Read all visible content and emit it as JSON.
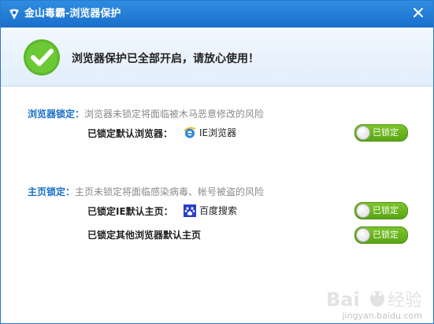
{
  "window": {
    "title": "金山毒霸-浏览器保护",
    "close_glyph": "×"
  },
  "banner": {
    "message": "浏览器保护已全部开启，请放心使用！"
  },
  "sections": [
    {
      "heading": "浏览器锁定：",
      "description": "浏览器未锁定将面临被木马恶意修改的风险",
      "rows": [
        {
          "label": "已锁定默认浏览器：",
          "value": "IE浏览器",
          "icon": "ie-icon",
          "toggle": "已锁定",
          "locked": true
        }
      ]
    },
    {
      "heading": "主页锁定：",
      "description": "主页未锁定将面临感染病毒、帐号被盗的风险",
      "rows": [
        {
          "label": "已锁定IE默认主页：",
          "value": "百度搜索",
          "icon": "baidu-paw-icon",
          "toggle": "已锁定",
          "locked": true
        },
        {
          "label": "已锁定其他浏览器默认主页",
          "value": "",
          "icon": "",
          "toggle": "已锁定",
          "locked": true
        }
      ]
    }
  ],
  "watermark": {
    "text": "jingyan.baidu.com"
  },
  "colors": {
    "titlebar": "#1a6fcc",
    "accent": "#1d6fc7",
    "toggle_on": "#6db81f",
    "check": "#5bb82a"
  }
}
